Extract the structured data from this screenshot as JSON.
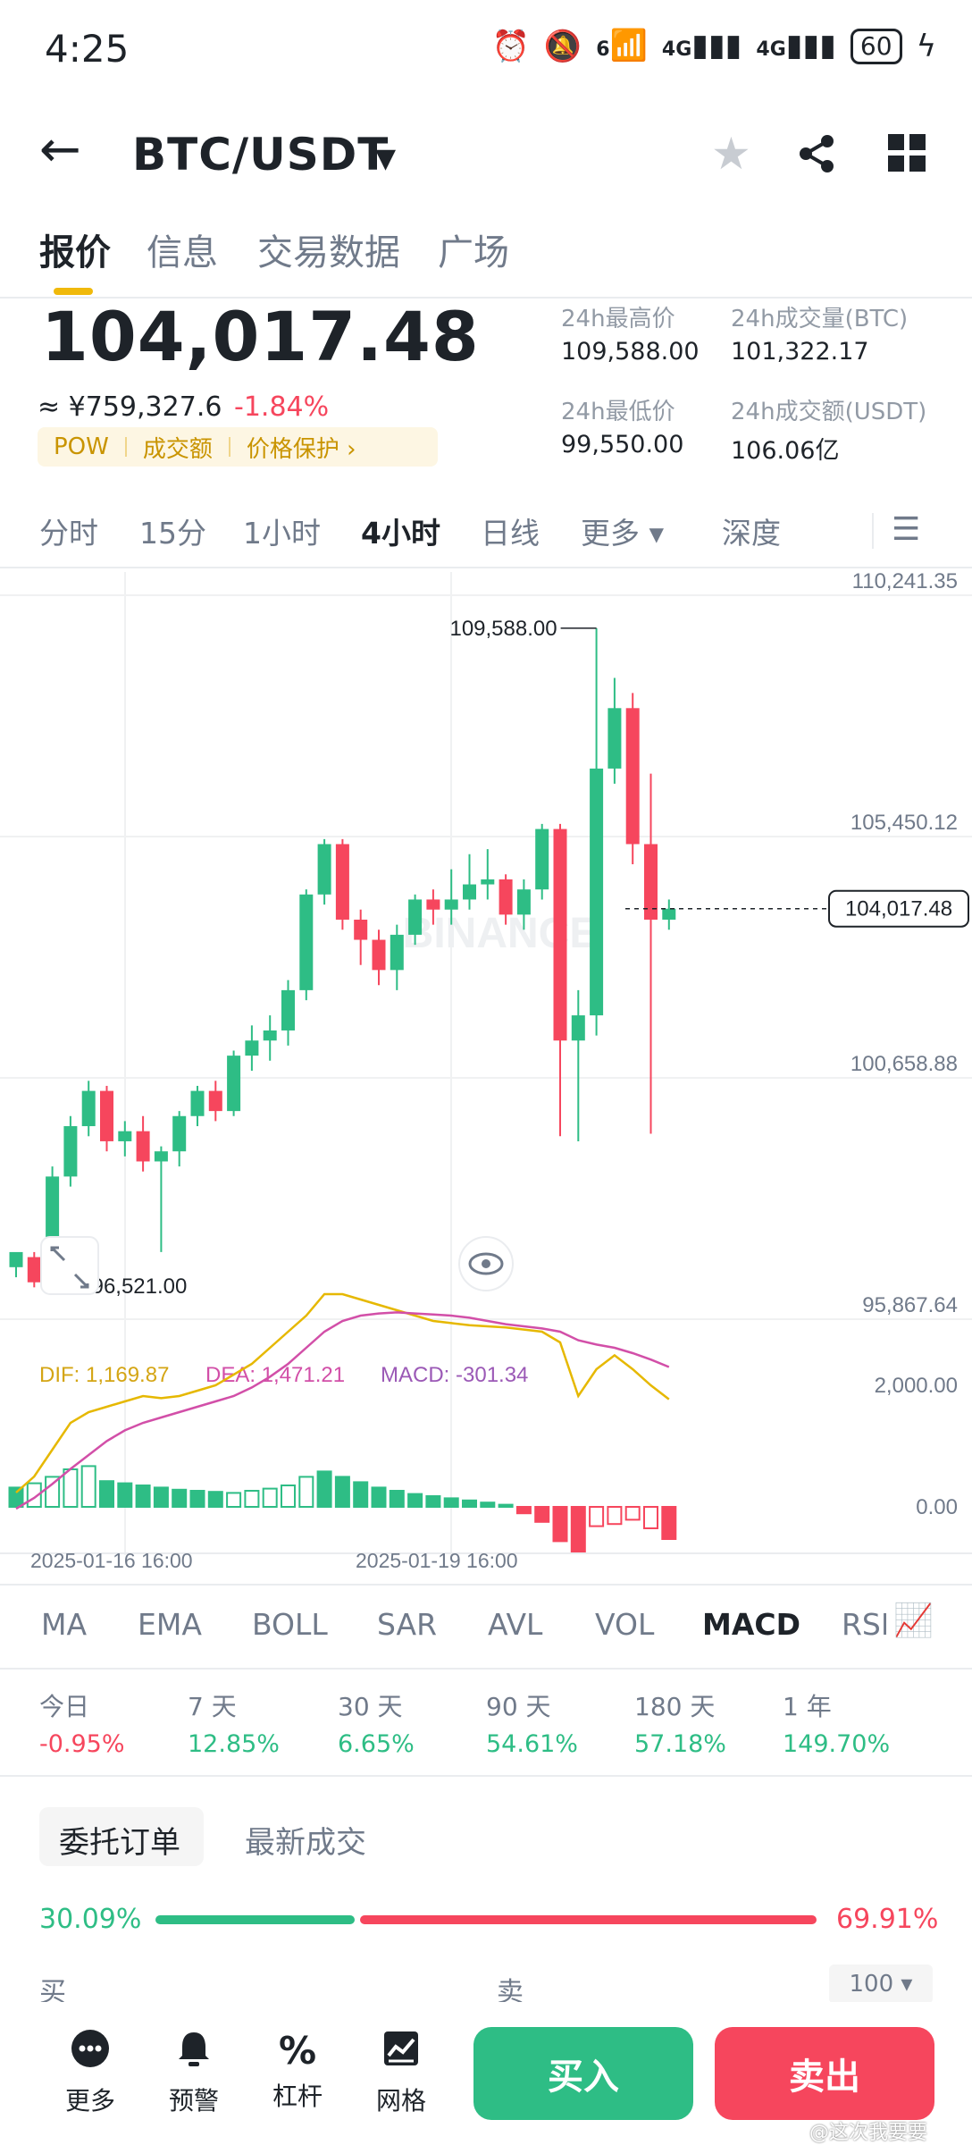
{
  "status_bar": {
    "time": "4:25",
    "net1": "4G",
    "net2": "4G",
    "wifi_sub": "6",
    "battery": "60"
  },
  "header": {
    "pair": "BTC/USDT"
  },
  "tabs": [
    "报价",
    "信息",
    "交易数据",
    "广场"
  ],
  "ticker": {
    "price": "104,017.48",
    "cny": "≈ ¥759,327.6",
    "change": "-1.84%",
    "tags": [
      "POW",
      "成交额",
      "价格保护 ›"
    ],
    "stats": [
      {
        "label": "24h最高价",
        "value": "109,588.00"
      },
      {
        "label": "24h成交量(BTC)",
        "value": "101,322.17"
      },
      {
        "label": "24h最低价",
        "value": "99,550.00"
      },
      {
        "label": "24h成交额(USDT)",
        "value": "106.06亿"
      }
    ]
  },
  "intervals": [
    "分时",
    "15分",
    "1小时",
    "4小时",
    "日线",
    "更多 ▾",
    "深度"
  ],
  "chart_data": {
    "type": "candlestick",
    "price_axis": [
      "110,241.35",
      "105,450.12",
      "100,658.88",
      "95,867.64"
    ],
    "ylim": [
      95867.64,
      110241.35
    ],
    "high_label": "109,588.00",
    "low_label": "96,521.00",
    "current_price": "104,017.48",
    "watermark": "BINANCE",
    "candles": [
      [
        96900,
        97200,
        96700,
        97100
      ],
      [
        97100,
        96600,
        96500,
        97200
      ],
      [
        96600,
        98700,
        96521,
        98900
      ],
      [
        98700,
        99700,
        98500,
        99900
      ],
      [
        99700,
        100400,
        99500,
        100600
      ],
      [
        100400,
        99400,
        99200,
        100500
      ],
      [
        99400,
        99600,
        99100,
        99800
      ],
      [
        99600,
        99000,
        98800,
        99900
      ],
      [
        99000,
        99200,
        97200,
        99300
      ],
      [
        99200,
        99900,
        98900,
        100000
      ],
      [
        99900,
        100400,
        99700,
        100500
      ],
      [
        100400,
        100000,
        99800,
        100600
      ],
      [
        100000,
        101100,
        99900,
        101200
      ],
      [
        101100,
        101400,
        100800,
        101700
      ],
      [
        101400,
        101600,
        101000,
        101900
      ],
      [
        101600,
        102400,
        101300,
        102600
      ],
      [
        102400,
        104300,
        102200,
        104400
      ],
      [
        104300,
        105300,
        104100,
        105400
      ],
      [
        105300,
        103800,
        103600,
        105400
      ],
      [
        103800,
        103400,
        102900,
        104000
      ],
      [
        103400,
        102800,
        102500,
        103600
      ],
      [
        102800,
        103500,
        102400,
        103700
      ],
      [
        103500,
        104200,
        103300,
        104300
      ],
      [
        104200,
        104000,
        103700,
        104400
      ],
      [
        104000,
        104200,
        103700,
        104800
      ],
      [
        104200,
        104500,
        104000,
        105100
      ],
      [
        104500,
        104600,
        104200,
        105200
      ],
      [
        104600,
        103900,
        103700,
        104700
      ],
      [
        103900,
        104400,
        103600,
        104600
      ],
      [
        104400,
        105600,
        104200,
        105700
      ],
      [
        105600,
        101400,
        99500,
        105700
      ],
      [
        101400,
        101900,
        99400,
        102400
      ],
      [
        101900,
        106800,
        101500,
        109588
      ],
      [
        106800,
        108000,
        106500,
        108600
      ],
      [
        108000,
        105300,
        104900,
        108300
      ],
      [
        105300,
        103800,
        99550,
        106700
      ],
      [
        103800,
        104017.48,
        103600,
        104200
      ]
    ],
    "macd": {
      "dif_label": "DIF: 1,169.87",
      "dea_label": "DEA: 1,471.21",
      "macd_label": "MACD: -301.34",
      "axis": [
        "2,000.00",
        "0.00"
      ],
      "hist": [
        180,
        220,
        280,
        350,
        380,
        240,
        220,
        200,
        180,
        160,
        150,
        140,
        130,
        150,
        170,
        200,
        280,
        330,
        280,
        230,
        180,
        150,
        120,
        100,
        80,
        60,
        40,
        20,
        -60,
        -140,
        -320,
        -420,
        -180,
        -160,
        -120,
        -200,
        -300
      ],
      "dif": [
        300,
        450,
        700,
        950,
        1050,
        1100,
        1150,
        1200,
        1180,
        1200,
        1250,
        1300,
        1400,
        1500,
        1650,
        1800,
        1950,
        2150,
        2150,
        2100,
        2050,
        2000,
        1950,
        1900,
        1880,
        1860,
        1850,
        1840,
        1820,
        1800,
        1700,
        1200,
        1450,
        1580,
        1450,
        1300,
        1170
      ],
      "dea": [
        150,
        250,
        380,
        520,
        650,
        780,
        880,
        950,
        1000,
        1050,
        1100,
        1150,
        1200,
        1280,
        1380,
        1500,
        1650,
        1800,
        1900,
        1950,
        1970,
        1980,
        1970,
        1960,
        1950,
        1930,
        1900,
        1870,
        1850,
        1830,
        1800,
        1720,
        1680,
        1650,
        1600,
        1540,
        1471
      ],
      "dates": [
        "2025-01-16 16:00",
        "2025-01-19 16:00"
      ]
    }
  },
  "indicators": [
    "MA",
    "EMA",
    "BOLL",
    "SAR",
    "AVL",
    "VOL",
    "MACD",
    "RSI"
  ],
  "performance": [
    {
      "label": "今日",
      "value": "-0.95%"
    },
    {
      "label": "7 天",
      "value": "12.85%"
    },
    {
      "label": "30 天",
      "value": "6.65%"
    },
    {
      "label": "90 天",
      "value": "54.61%"
    },
    {
      "label": "180 天",
      "value": "57.18%"
    },
    {
      "label": "1 年",
      "value": "149.70%"
    }
  ],
  "orders": {
    "tabs": [
      "委托订单",
      "最新成交"
    ],
    "buy_pct": "30.09%",
    "sell_pct": "69.91%",
    "buy_ratio": 0.3009,
    "buy_label": "买",
    "sell_label": "卖",
    "depth": "100 ▾"
  },
  "bottom_nav": [
    {
      "label": "更多",
      "icon": "more-icon"
    },
    {
      "label": "预警",
      "icon": "bell-icon"
    },
    {
      "label": "杠杆",
      "icon": "percent-icon"
    },
    {
      "label": "网格",
      "icon": "grid-trading-icon"
    }
  ],
  "actions": {
    "buy": "买入",
    "sell": "卖出"
  },
  "watermark_text": "@这次我要要"
}
